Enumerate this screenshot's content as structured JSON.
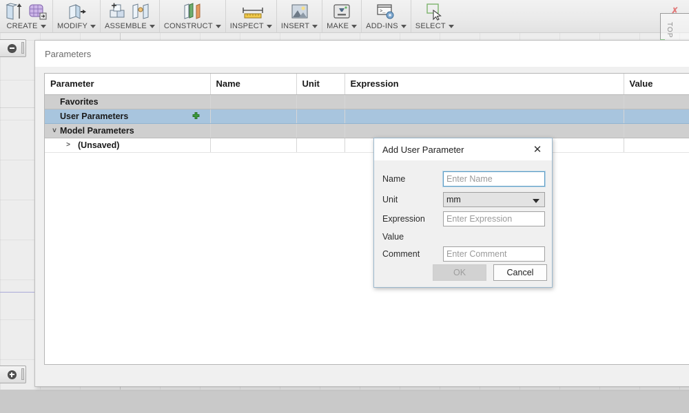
{
  "toolbar": {
    "groups": [
      {
        "label": "CREATE",
        "icons": [
          "extrude-icon",
          "mesh-create-icon"
        ]
      },
      {
        "label": "MODIFY",
        "icons": [
          "press-pull-icon"
        ]
      },
      {
        "label": "ASSEMBLE",
        "icons": [
          "new-component-icon",
          "joint-icon"
        ]
      },
      {
        "label": "CONSTRUCT",
        "icons": [
          "offset-plane-icon"
        ]
      },
      {
        "label": "INSPECT",
        "icons": [
          "measure-icon"
        ]
      },
      {
        "label": "INSERT",
        "icons": [
          "insert-image-icon"
        ]
      },
      {
        "label": "MAKE",
        "icons": [
          "3d-print-icon"
        ]
      },
      {
        "label": "ADD-INS",
        "icons": [
          "scripts-addins-icon"
        ]
      },
      {
        "label": "SELECT",
        "icons": [
          "select-cursor-icon"
        ]
      }
    ]
  },
  "viewcube": {
    "face_label": "TOP"
  },
  "browser": {
    "collapse_top_label": "collapse-browser",
    "collapse_bottom_label": "expand-browser"
  },
  "panel": {
    "title": "Parameters",
    "columns": [
      "Parameter",
      "Name",
      "Unit",
      "Expression",
      "Value"
    ],
    "rows": [
      {
        "kind": "group",
        "twisty": "",
        "indent": 22,
        "label": "Favorites",
        "has_add": false
      },
      {
        "kind": "selected",
        "twisty": "",
        "indent": 22,
        "label": "User Parameters",
        "has_add": true
      },
      {
        "kind": "group",
        "twisty": "v",
        "indent": 22,
        "label": "Model Parameters",
        "has_add": false
      },
      {
        "kind": "leaf",
        "twisty": ">",
        "indent": 73,
        "label": "(Unsaved)",
        "has_add": false
      }
    ]
  },
  "dialog": {
    "title": "Add User Parameter",
    "close_label": "✕",
    "fields": [
      {
        "label": "Name",
        "control": "text",
        "value": "",
        "placeholder": "Enter Name",
        "focused": true
      },
      {
        "label": "Unit",
        "control": "select",
        "value": "mm",
        "placeholder": "",
        "focused": false
      },
      {
        "label": "Expression",
        "control": "text",
        "value": "",
        "placeholder": "Enter Expression",
        "focused": false
      },
      {
        "label": "Value",
        "control": "none",
        "value": "",
        "placeholder": "",
        "focused": false
      },
      {
        "label": "Comment",
        "control": "text",
        "value": "",
        "placeholder": "Enter Comment",
        "focused": false
      }
    ],
    "ok_label": "OK",
    "cancel_label": "Cancel",
    "ok_enabled": false
  },
  "colors": {
    "selection_blue": "#a8c5de",
    "group_grey": "#cfcfcf",
    "add_green": "#3a9b3a",
    "focus_border": "#5b9bc4",
    "canvas": "#ededed"
  }
}
